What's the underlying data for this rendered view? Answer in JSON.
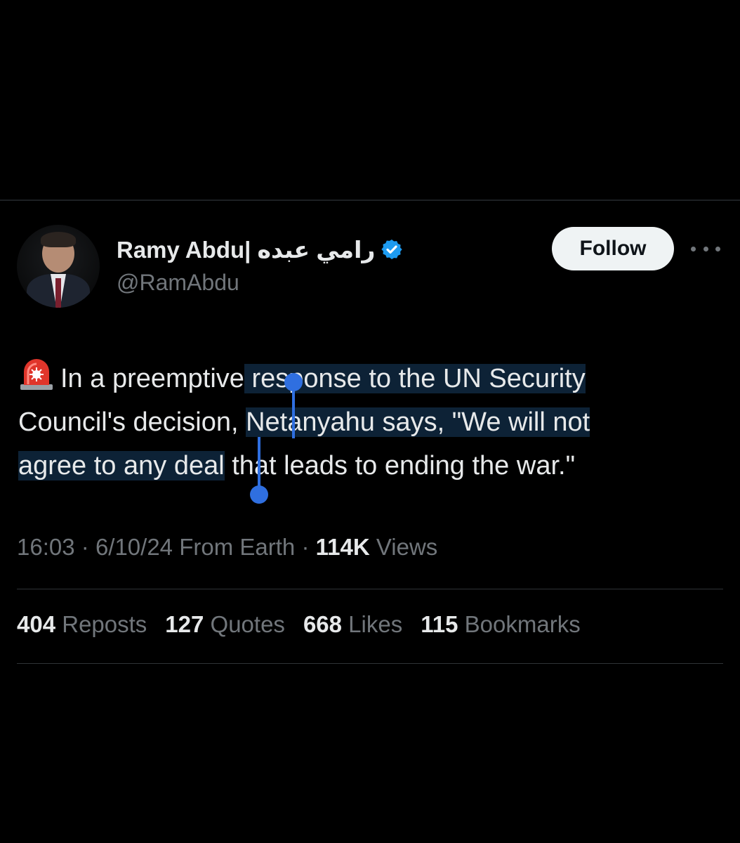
{
  "author": {
    "display_name": "Ramy Abdu| رامي عبده",
    "handle": "@RamAbdu",
    "verified": true
  },
  "actions": {
    "follow_label": "Follow",
    "more_icon": "more-horizontal-icon"
  },
  "tweet": {
    "emoji": "siren-icon",
    "line1_pre": "In a preemptive",
    "line1_post": " response to the UN Security",
    "line2_pre": "Council's decision, ",
    "line2_sel": "Netanyahu says, \"We will not",
    "line3_sel": "agree to any deal",
    "line3_post": " that leads to ending the war.\""
  },
  "meta": {
    "time": "16:03",
    "date": "6/10/24",
    "source": "From Earth",
    "views_count": "114K",
    "views_label": "Views"
  },
  "stats": [
    {
      "count": "404",
      "label": "Reposts"
    },
    {
      "count": "127",
      "label": "Quotes"
    },
    {
      "count": "668",
      "label": "Likes"
    },
    {
      "count": "115",
      "label": "Bookmarks"
    }
  ],
  "colors": {
    "background": "#000000",
    "text": "#e7e9ea",
    "secondary": "#71767b",
    "verified": "#1d9bf0",
    "selection": "#0d2236",
    "selection_handle": "#2f6fe0"
  }
}
